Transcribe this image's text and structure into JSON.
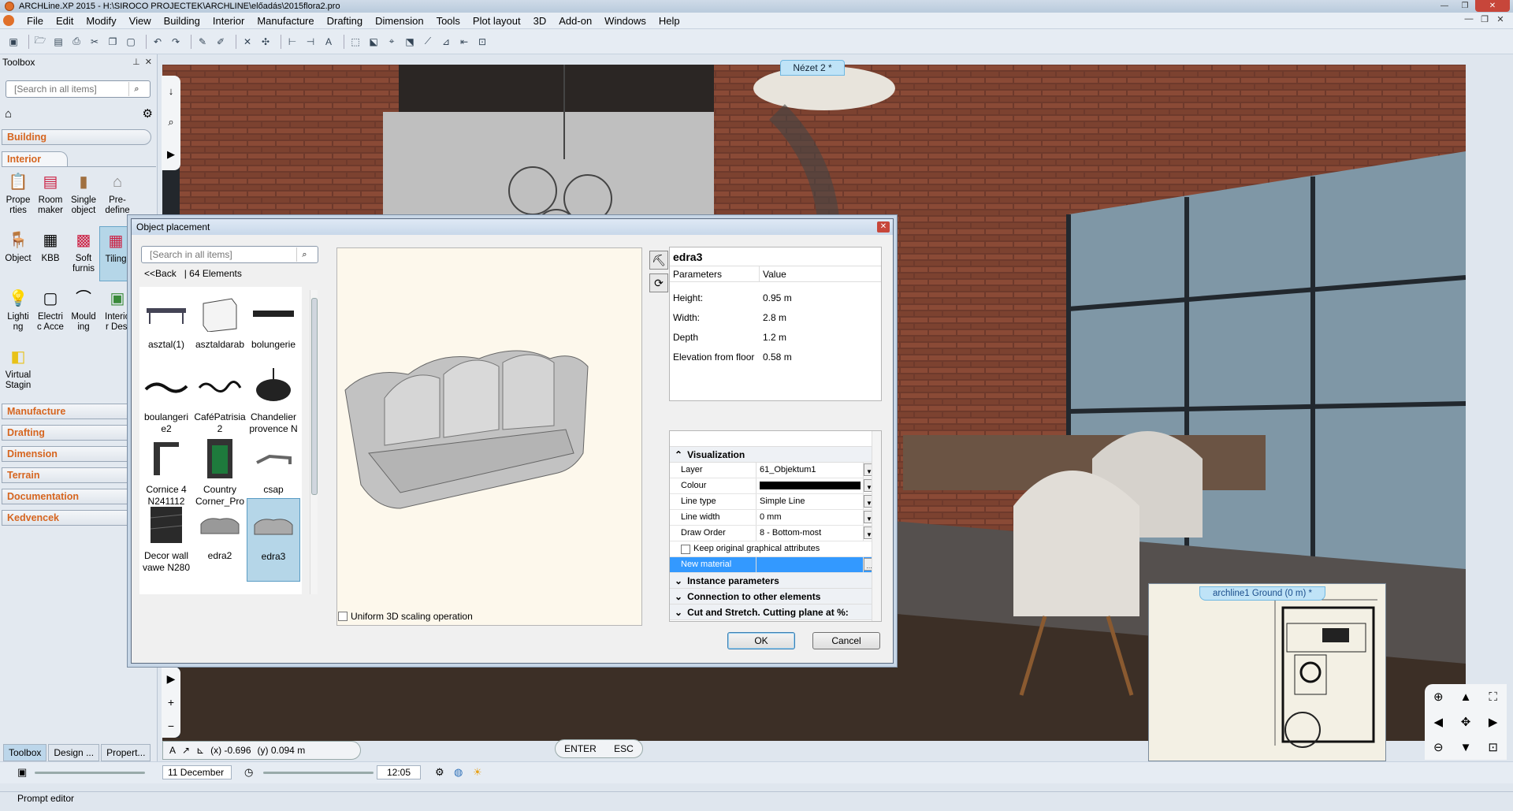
{
  "window": {
    "title": "ARCHLine.XP 2015 - H:\\SIROCO PROJECTEK\\ARCHLINE\\előadás\\2015flora2.pro"
  },
  "menu": {
    "items": [
      "File",
      "Edit",
      "Modify",
      "View",
      "Building",
      "Interior",
      "Manufacture",
      "Drafting",
      "Dimension",
      "Tools",
      "Plot layout",
      "3D",
      "Add-on",
      "Windows",
      "Help"
    ]
  },
  "toolbox": {
    "title": "Toolbox",
    "search_placeholder": "[Search in all items]",
    "categories_top": "Building",
    "open_category": "Interior",
    "tools": [
      {
        "l1": "Prope",
        "l2": "rties",
        "icon": "properties-icon"
      },
      {
        "l1": "Room",
        "l2": "maker",
        "icon": "room-maker-icon"
      },
      {
        "l1": "Single",
        "l2": "object",
        "icon": "single-object-icon"
      },
      {
        "l1": "Pre-",
        "l2": "define",
        "icon": "predefined-icon"
      },
      {
        "l1": "Object",
        "l2": "",
        "icon": "object-icon"
      },
      {
        "l1": "KBB",
        "l2": "",
        "icon": "kbb-icon"
      },
      {
        "l1": "Soft",
        "l2": "furnis",
        "icon": "soft-furnishing-icon"
      },
      {
        "l1": "Tiling",
        "l2": "",
        "icon": "tiling-icon"
      },
      {
        "l1": "Lighti",
        "l2": "ng",
        "icon": "lighting-icon"
      },
      {
        "l1": "Electri",
        "l2": "c Acce",
        "icon": "electric-icon"
      },
      {
        "l1": "Mould",
        "l2": "ing",
        "icon": "moulding-icon"
      },
      {
        "l1": "Interio",
        "l2": "r Desi",
        "icon": "interior-design-icon"
      },
      {
        "l1": "Virtual",
        "l2": "Stagin",
        "icon": "virtual-staging-icon"
      }
    ],
    "categories": [
      "Manufacture",
      "Drafting",
      "Dimension",
      "Terrain",
      "Documentation",
      "Kedvencek"
    ],
    "bottom_tabs": [
      "Toolbox",
      "Design ...",
      "Propert..."
    ]
  },
  "viewport": {
    "tab": "Nézet 2 *"
  },
  "status": {
    "x": "(x) -0.696",
    "y": "(y) 0.094 m",
    "enter": "ENTER",
    "esc": "ESC",
    "date": "11 December",
    "time": "12:05"
  },
  "minimap": {
    "title": "archline1 Ground (0 m) *"
  },
  "prompt": {
    "label": "Prompt editor"
  },
  "dialog": {
    "title": "Object placement",
    "search_placeholder": "[Search in all items]",
    "back": "<<Back",
    "count": "| 64 Elements",
    "items": [
      {
        "label": "asztal(1)",
        "icon": "table-icon"
      },
      {
        "label": "asztaldarab",
        "icon": "table-piece-icon"
      },
      {
        "label": "bolungerie",
        "icon": "sign-icon"
      },
      {
        "label": "boulangeri e2",
        "icon": "sign-icon"
      },
      {
        "label": "CaféPatrisia 2",
        "icon": "sign-icon"
      },
      {
        "label": "Chandelier provence N",
        "icon": "chandelier-icon"
      },
      {
        "label": "Cornice 4 N241112",
        "icon": "cornice-icon"
      },
      {
        "label": "Country Corner_Pro",
        "icon": "cabinet-icon"
      },
      {
        "label": "csap",
        "icon": "tap-icon"
      },
      {
        "label": "Decor wall vawe N280",
        "icon": "wall-panel-icon"
      },
      {
        "label": "edra2",
        "icon": "sofa-icon"
      },
      {
        "label": "edra3",
        "icon": "sofa-icon"
      }
    ],
    "uniform_label": "Uniform 3D scaling operation",
    "object_name": "edra3",
    "params_header": "Parameters",
    "value_header": "Value",
    "params": [
      {
        "k": "Height:",
        "v": "0.95 m"
      },
      {
        "k": "Width:",
        "v": "2.8 m"
      },
      {
        "k": "Depth",
        "v": "1.2 m"
      },
      {
        "k": "Elevation from floor",
        "v": "0.58 m"
      }
    ],
    "vis_section": "Visualization",
    "vis_rows": [
      {
        "k": "Layer",
        "v": "61_Objektum1"
      },
      {
        "k": "Colour",
        "v": ""
      },
      {
        "k": "Line type",
        "v": "Simple Line"
      },
      {
        "k": "Line width",
        "v": "0 mm"
      },
      {
        "k": "Draw Order",
        "v": "8 - Bottom-most"
      }
    ],
    "keep_attrs": "Keep original graphical attributes",
    "new_material": "New material",
    "sections": [
      "Instance parameters",
      "Connection to other elements",
      "Cut and Stretch. Cutting plane at %:"
    ],
    "ok": "OK",
    "cancel": "Cancel",
    "accent": "#3399ff"
  }
}
